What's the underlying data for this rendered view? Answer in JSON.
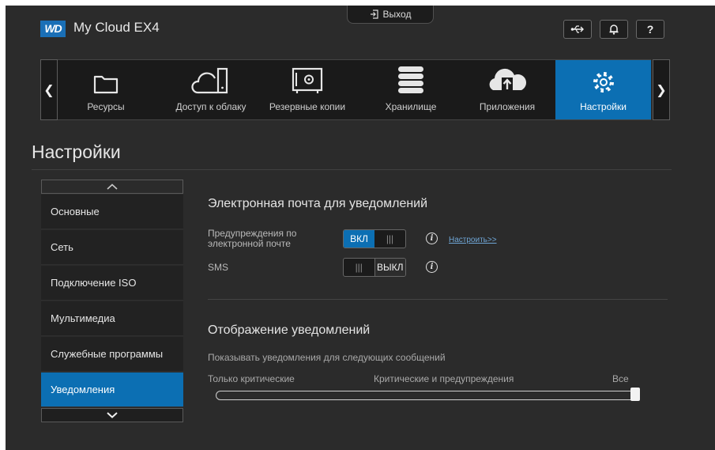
{
  "header": {
    "logo_text": "WD",
    "product_name": "My Cloud EX4",
    "logout_label": "Выход",
    "buttons": [
      {
        "icon": "usb-icon"
      },
      {
        "icon": "bell-icon"
      },
      {
        "label": "?",
        "icon": "help-icon"
      }
    ]
  },
  "nav": {
    "items": [
      {
        "label": "Ресурсы",
        "icon": "folder-icon"
      },
      {
        "label": "Доступ к облаку",
        "icon": "cloud-device-icon"
      },
      {
        "label": "Резервные копии",
        "icon": "safe-icon"
      },
      {
        "label": "Хранилище",
        "icon": "database-icon"
      },
      {
        "label": "Приложения",
        "icon": "apps-cloud-icon"
      },
      {
        "label": "Настройки",
        "icon": "gear-icon",
        "active": true
      }
    ]
  },
  "page": {
    "title": "Настройки"
  },
  "sidebar": {
    "items": [
      {
        "label": "Основные"
      },
      {
        "label": "Сеть"
      },
      {
        "label": "Подключение ISO"
      },
      {
        "label": "Мультимедиа"
      },
      {
        "label": "Служебные программы"
      },
      {
        "label": "Уведомления",
        "active": true
      }
    ]
  },
  "email_section": {
    "title": "Электронная почта для уведомлений",
    "email_alerts": {
      "label_line1": "Предупреждения по",
      "label_line2": "электронной почте",
      "toggle_on": "ВКЛ",
      "toggle_state": "on",
      "configure_link": "Настроить>>"
    },
    "sms": {
      "label": "SMS",
      "toggle_off": "ВЫКЛ",
      "toggle_state": "off"
    },
    "grip": "|||"
  },
  "display_section": {
    "title": "Отображение уведомлений",
    "description": "Показывать уведомления для следующих сообщений",
    "slider": {
      "labels": [
        "Только критические",
        "Критические и предупреждения",
        "Все"
      ],
      "selected": "Все",
      "value": 1.0
    }
  },
  "colors": {
    "accent": "#0c6fb3",
    "background": "#2b2b2b",
    "link": "#6fa6d6"
  }
}
